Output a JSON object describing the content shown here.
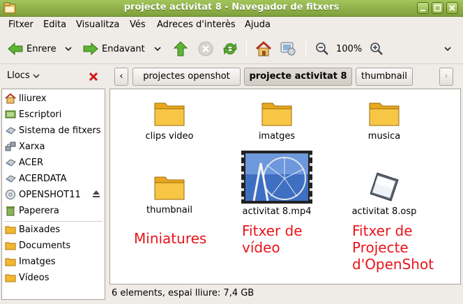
{
  "window": {
    "title": "projecte activitat 8 - Navegador de fitxers"
  },
  "menubar": {
    "items": [
      "Fitxer",
      "Edita",
      "Visualitza",
      "Vés",
      "Adreces d'interès",
      "Ajuda"
    ]
  },
  "toolbar": {
    "back_label": "Enrere",
    "forward_label": "Endavant",
    "zoom_level": "100%"
  },
  "location": {
    "places_label": "Llocs",
    "breadcrumbs": [
      "projectes openshot",
      "projecte activitat 8",
      "thumbnail"
    ],
    "active_crumb": "projecte activitat 8"
  },
  "sidebar": {
    "devices": [
      {
        "label": "lliurex",
        "icon": "home-icon"
      },
      {
        "label": "Escriptori",
        "icon": "desktop-icon"
      },
      {
        "label": "Sistema de fitxers",
        "icon": "drive-icon"
      },
      {
        "label": "Xarxa",
        "icon": "network-icon"
      },
      {
        "label": "ACER",
        "icon": "drive-icon"
      },
      {
        "label": "ACERDATA",
        "icon": "drive-icon"
      },
      {
        "label": "OPENSHOT11",
        "icon": "disc-icon"
      },
      {
        "label": "Paperera",
        "icon": "trash-icon"
      }
    ],
    "bookmarks": [
      {
        "label": "Baixades",
        "icon": "folder-icon"
      },
      {
        "label": "Documents",
        "icon": "folder-icon"
      },
      {
        "label": "Imatges",
        "icon": "folder-icon"
      },
      {
        "label": "Vídeos",
        "icon": "folder-icon"
      }
    ]
  },
  "files": [
    {
      "name": "clips video",
      "type": "folder"
    },
    {
      "name": "imatges",
      "type": "folder"
    },
    {
      "name": "musica",
      "type": "folder"
    },
    {
      "name": "thumbnail",
      "type": "folder"
    },
    {
      "name": "activitat 8.mp4",
      "type": "video"
    },
    {
      "name": "activitat 8.osp",
      "type": "project"
    }
  ],
  "annotations": [
    {
      "text": "Miniatures"
    },
    {
      "text": "Fitxer de\nvídeo"
    },
    {
      "text": "Fitxer de\nProjecte\nd'OpenShot"
    }
  ],
  "annotation_lines": {
    "miniatures": [
      "Miniatures"
    ],
    "video": [
      "Fitxer de",
      "vídeo"
    ],
    "project": [
      "Fitxer de",
      "Projecte",
      "d'OpenShot"
    ]
  },
  "statusbar": {
    "text": "6 elements, espai lliure: 7,4 GB"
  },
  "colors": {
    "titlebar": "#8fb04a",
    "annotation": "#e8141b",
    "folder": "#f5b82c"
  }
}
